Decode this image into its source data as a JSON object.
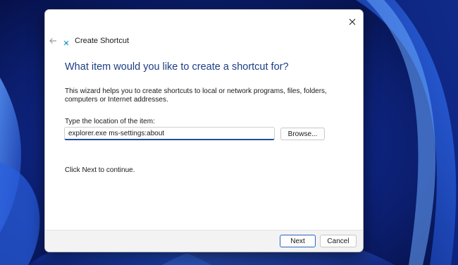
{
  "wallpaper": {
    "name": "Windows 11 bloom wallpaper",
    "colors": {
      "dark": "#061452",
      "mid": "#1432a8",
      "light": "#3f7cf2"
    }
  },
  "dialog": {
    "window_title": "Create Shortcut",
    "heading": "What item would you like to create a shortcut for?",
    "description": "This wizard helps you to create shortcuts to local or network programs, files, folders, computers or Internet addresses.",
    "location_label": "Type the location of the item:",
    "location_value": "explorer.exe ms-settings:about",
    "browse_label": "Browse...",
    "hint": "Click Next to continue.",
    "next_label": "Next",
    "cancel_label": "Cancel",
    "accent_color": "#1c3d85",
    "icons": {
      "close": "close-icon",
      "back": "back-arrow-icon",
      "app": "shortcut-app-icon"
    }
  }
}
